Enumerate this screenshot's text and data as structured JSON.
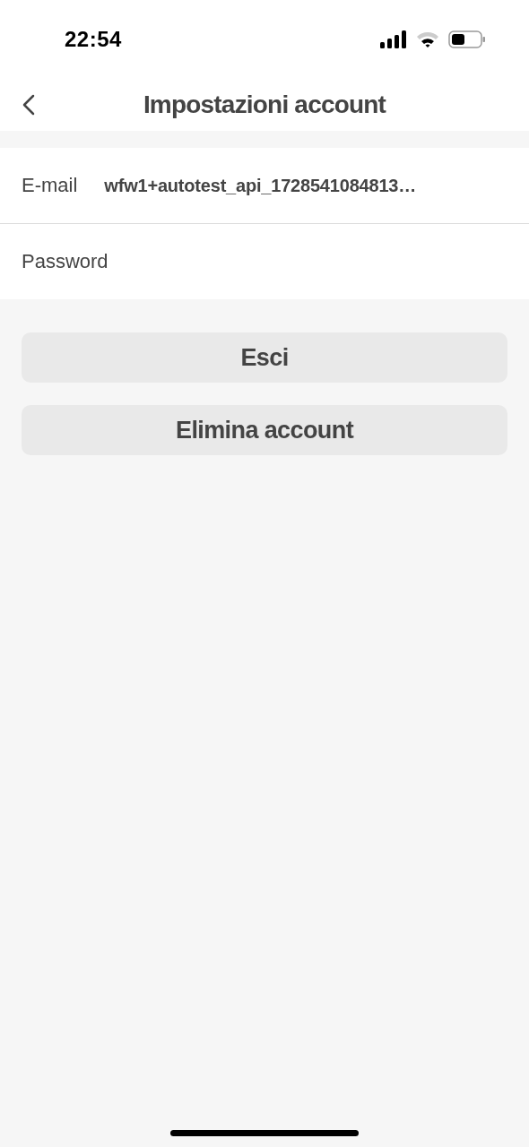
{
  "status_bar": {
    "time": "22:54"
  },
  "nav": {
    "title": "Impostazioni account"
  },
  "rows": [
    {
      "label": "E-mail",
      "value": "wfw1+autotest_api_1728541084813…"
    },
    {
      "label": "Password"
    }
  ],
  "buttons": [
    "Esci",
    "Elimina account"
  ]
}
